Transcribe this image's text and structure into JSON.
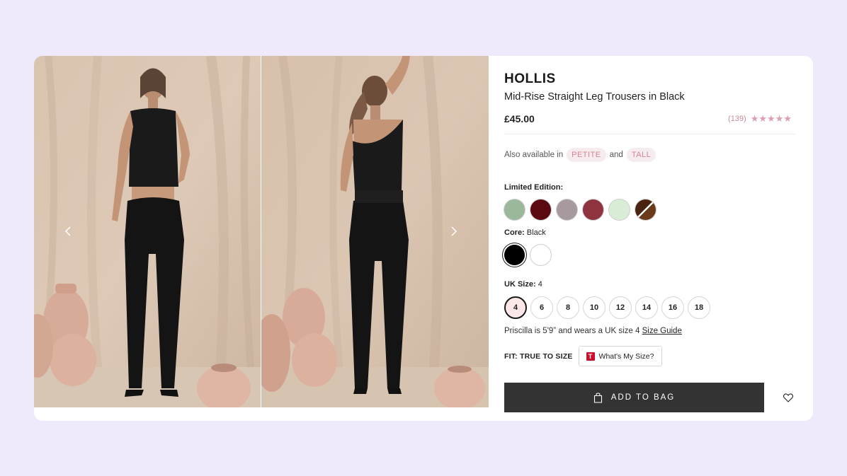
{
  "product": {
    "brand": "HOLLIS",
    "name": "Mid-Rise Straight Leg Trousers in Black",
    "price": "£45.00",
    "review_count": "(139)",
    "rating_stars": "★★★★★",
    "rating_value": 5
  },
  "availability": {
    "prefix": "Also available in",
    "conjunction": "and",
    "options": [
      "PETITE",
      "TALL"
    ]
  },
  "colors": {
    "limited_label": "Limited Edition:",
    "limited_swatches": [
      "#9bb89c",
      "#5a0a10",
      "#a79a9e",
      "#8f3340",
      "#d8ecd6",
      "split-brown-white"
    ],
    "core_label": "Core:",
    "core_selected": "Black",
    "core_swatches": [
      "#000000",
      "#ffffff"
    ]
  },
  "sizes": {
    "label": "UK Size:",
    "selected": "4",
    "options": [
      "4",
      "6",
      "8",
      "10",
      "12",
      "14",
      "16",
      "18"
    ]
  },
  "model_info": {
    "text": "Priscilla is 5'9” and wears a UK size 4",
    "link": "Size Guide"
  },
  "fit": {
    "label": "FIT: TRUE TO SIZE",
    "button": "What's My Size?",
    "logo_letter": "T"
  },
  "actions": {
    "add_to_bag": "ADD TO BAG"
  },
  "colors_theme": {
    "page_bg": "#efe9fc",
    "button_bg": "#333333",
    "pill_bg": "#f6ecef",
    "pill_text": "#d4848f",
    "star_color": "#d9a0ad"
  },
  "icons": {
    "prev": "chevron-left-icon",
    "next": "chevron-right-icon",
    "bag": "shopping-bag-icon",
    "wishlist": "heart-icon"
  }
}
